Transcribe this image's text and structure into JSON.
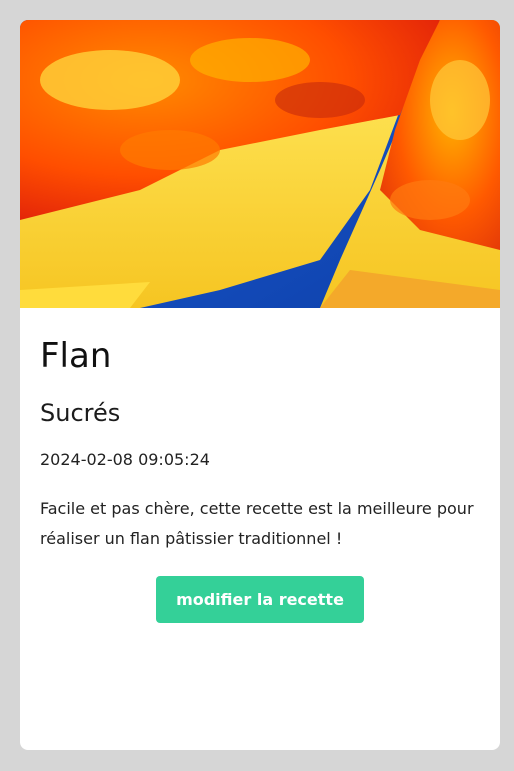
{
  "recipe": {
    "image_subject": "flan-photo",
    "title": "Flan",
    "category": "Sucrés",
    "date": "2024-02-08 09:05:24",
    "description": "Facile et pas chère, cette recette est la meilleure pour réaliser un flan pâtissier traditionnel !",
    "edit_button_label": "modifier la recette"
  },
  "colors": {
    "background": "#d6d6d6",
    "card": "#ffffff",
    "button": "#34d098"
  }
}
